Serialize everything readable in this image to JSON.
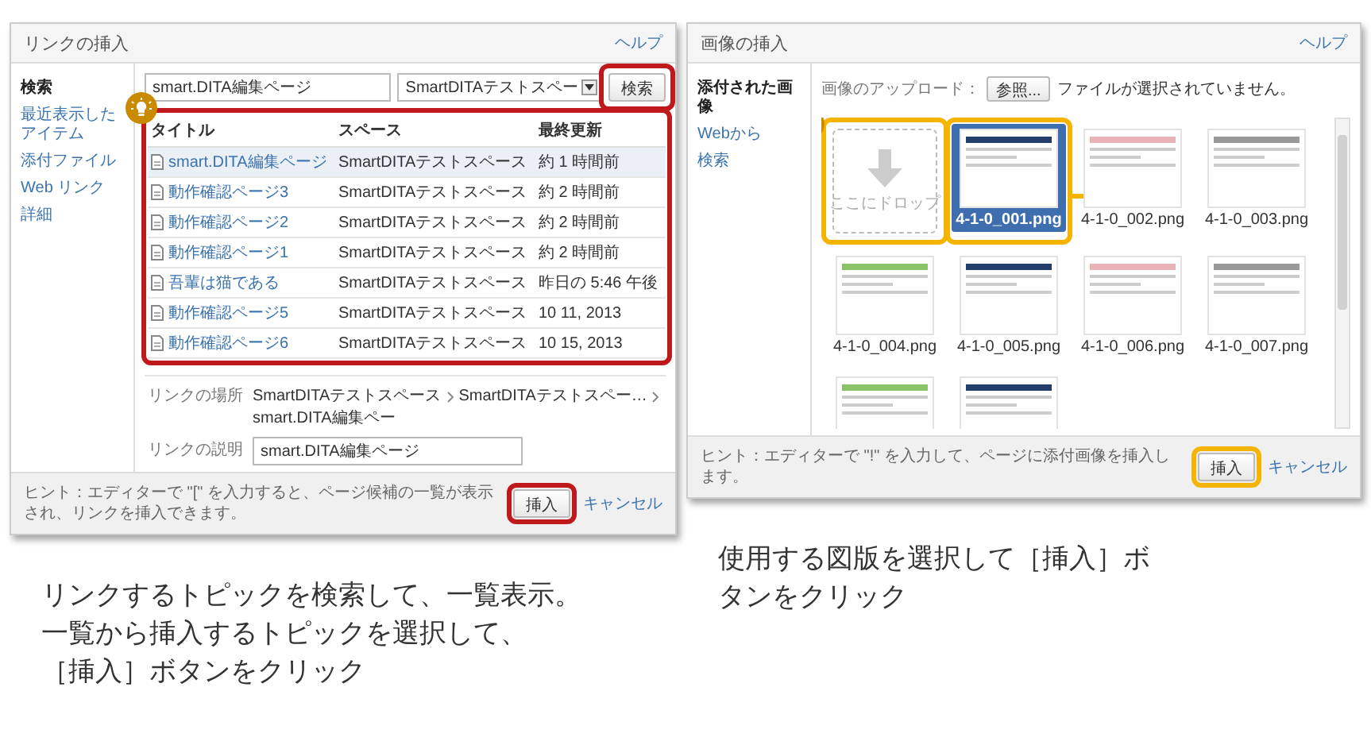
{
  "link_dialog": {
    "title": "リンクの挿入",
    "help": "ヘルプ",
    "sidebar": [
      {
        "label": "検索",
        "selected": true
      },
      {
        "label": "最近表示したアイテム",
        "selected": false
      },
      {
        "label": "添付ファイル",
        "selected": false
      },
      {
        "label": "Web リンク",
        "selected": false
      },
      {
        "label": "詳細",
        "selected": false
      }
    ],
    "search": {
      "value": "smart.DITA編集ページ",
      "space_select": "SmartDITAテストスペー",
      "button": "検索"
    },
    "table": {
      "columns": [
        "タイトル",
        "スペース",
        "最終更新"
      ],
      "rows": [
        {
          "title": "smart.DITA編集ページ",
          "space": "SmartDITAテストスペース",
          "updated": "約 1 時間前",
          "selected": true
        },
        {
          "title": "動作確認ページ3",
          "space": "SmartDITAテストスペース",
          "updated": "約 2 時間前",
          "selected": false
        },
        {
          "title": "動作確認ページ2",
          "space": "SmartDITAテストスペース",
          "updated": "約 2 時間前",
          "selected": false
        },
        {
          "title": "動作確認ページ1",
          "space": "SmartDITAテストスペース",
          "updated": "約 2 時間前",
          "selected": false
        },
        {
          "title": "吾輩は猫である",
          "space": "SmartDITAテストスペース",
          "updated": "昨日の 5:46 午後",
          "selected": false
        },
        {
          "title": "動作確認ページ5",
          "space": "SmartDITAテストスペース",
          "updated": "10 11, 2013",
          "selected": false
        },
        {
          "title": "動作確認ページ6",
          "space": "SmartDITAテストスペース",
          "updated": "10 15, 2013",
          "selected": false
        }
      ]
    },
    "link_location": {
      "label": "リンクの場所",
      "path": [
        "SmartDITAテストスペース",
        "SmartDITAテストスペー…",
        "smart.DITA編集ペー"
      ]
    },
    "link_description": {
      "label": "リンクの説明",
      "value": "smart.DITA編集ページ"
    },
    "hint": "ヒント：エディターで \"[\" を入力すると、ページ候補の一覧が表示され、リンクを挿入できます。",
    "insert": "挿入",
    "cancel": "キャンセル"
  },
  "image_dialog": {
    "title": "画像の挿入",
    "help": "ヘルプ",
    "sidebar": [
      {
        "label": "添付された画像",
        "selected": true
      },
      {
        "label": "Webから",
        "selected": false
      },
      {
        "label": "検索",
        "selected": false
      }
    ],
    "upload": {
      "label": "画像のアップロード：",
      "button": "参照...",
      "status": "ファイルが選択されていません。"
    },
    "drop_zone": "ここにドロップ",
    "images": [
      {
        "label": "4-1-0_001.png",
        "selected": true
      },
      {
        "label": "4-1-0_002.png",
        "selected": false
      },
      {
        "label": "4-1-0_003.png",
        "selected": false
      },
      {
        "label": "4-1-0_004.png",
        "selected": false
      },
      {
        "label": "4-1-0_005.png",
        "selected": false
      },
      {
        "label": "4-1-0_006.png",
        "selected": false
      },
      {
        "label": "4-1-0_007.png",
        "selected": false
      },
      {
        "selected": false
      },
      {
        "selected": false
      }
    ],
    "hint": "ヒント：エディターで \"!\" を入力して、ページに添付画像を挿入します。",
    "insert": "挿入",
    "cancel": "キャンセル"
  },
  "captions": [
    [
      "リンクするトピックを検索して、一覧表示。",
      "一覧から挿入するトピックを選択して、",
      "［挿入］ボタンをクリック"
    ],
    [
      "使用する図版を選択して［挿入］ボ",
      "タンをクリック"
    ]
  ]
}
